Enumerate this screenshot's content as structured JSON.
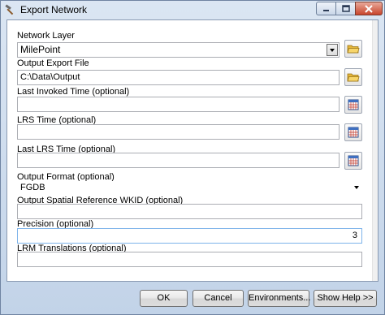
{
  "window": {
    "title": "Export Network",
    "icon": "hammer-icon"
  },
  "form": {
    "network_layer": {
      "label": "Network Layer",
      "value": "MilePoint"
    },
    "output_export_file": {
      "label": "Output Export File",
      "value": "C:\\Data\\Output"
    },
    "last_invoked_time": {
      "label": "Last Invoked Time (optional)",
      "value": ""
    },
    "lrs_time": {
      "label": "LRS Time (optional)",
      "value": ""
    },
    "last_lrs_time": {
      "label": "Last LRS Time (optional)",
      "value": ""
    },
    "output_format": {
      "label": "Output Format (optional)",
      "value": "FGDB"
    },
    "output_spatial_reference": {
      "label": "Output Spatial Reference WKID (optional)",
      "value": ""
    },
    "precision": {
      "label": "Precision (optional)",
      "value": "3"
    },
    "lrm_translations": {
      "label": "LRM Translations (optional)",
      "value": ""
    }
  },
  "buttons": {
    "ok": "OK",
    "cancel": "Cancel",
    "environments": "Environments...",
    "show_help": "Show Help >>"
  }
}
